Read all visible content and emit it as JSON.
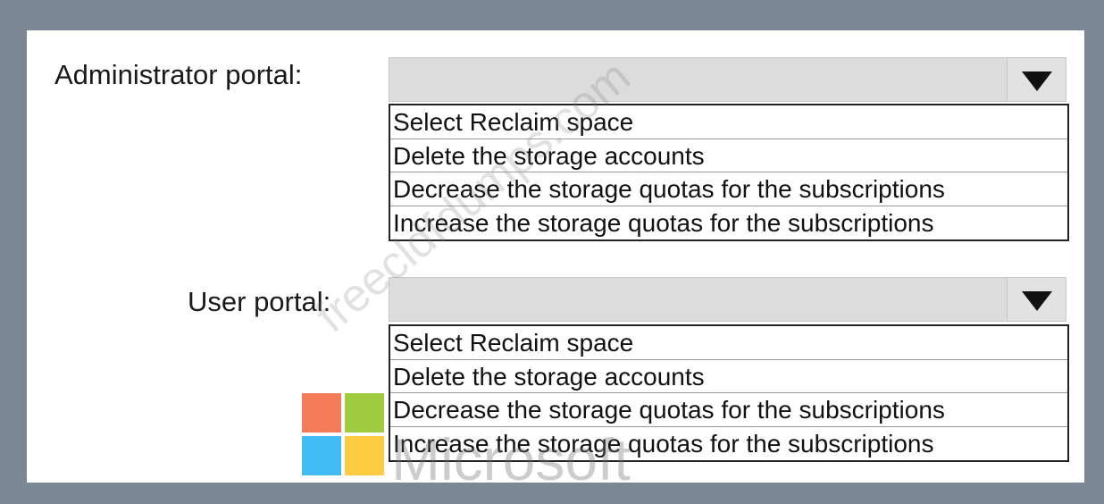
{
  "admin": {
    "label": "Administrator portal:",
    "selected_value": "",
    "options": [
      "Select Reclaim space",
      "Delete the storage accounts",
      "Decrease the storage quotas for the subscriptions",
      "Increase the storage quotas for the subscriptions"
    ]
  },
  "user": {
    "label": "User portal:",
    "selected_value": "",
    "options": [
      "Select Reclaim space",
      "Delete the storage accounts",
      "Decrease the storage quotas for the subscriptions",
      "Increase the storage quotas for the subscriptions"
    ]
  },
  "watermark": {
    "text": "freecldfdumps.com",
    "logo_text": "Microsoft",
    "logo_colors": [
      "#f25022",
      "#7fba00",
      "#00a4ef",
      "#ffb900"
    ]
  },
  "icons": {
    "dropdown": "triangle-down-icon"
  }
}
